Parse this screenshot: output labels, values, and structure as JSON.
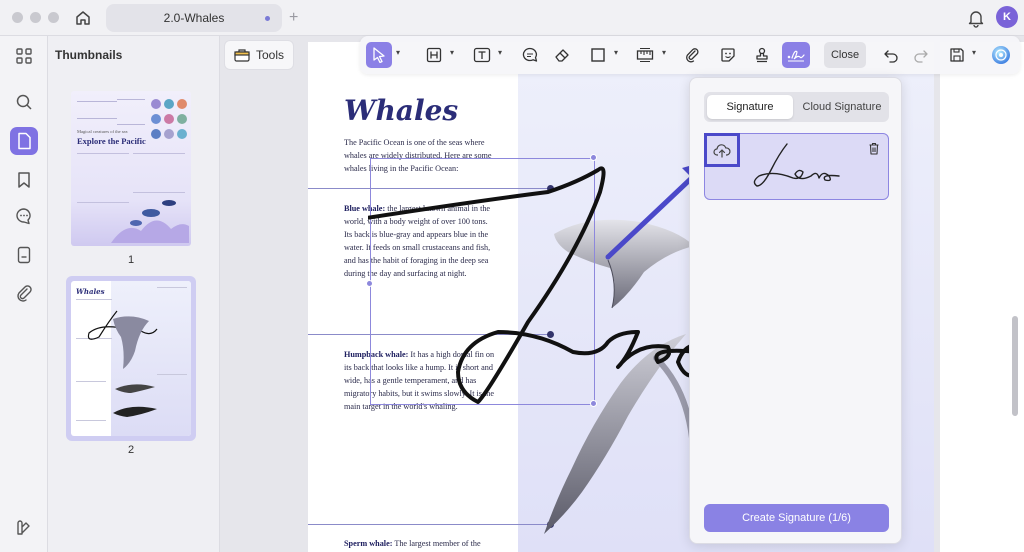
{
  "titlebar": {
    "tab_title": "2.0-Whales",
    "avatar_initial": "K"
  },
  "thumbnails": {
    "title": "Thumbnails",
    "pages": [
      {
        "number": "1"
      },
      {
        "number": "2"
      }
    ]
  },
  "thumb1": {
    "subtitle": "Magical creatures of the sea",
    "title": "Explore the Pacific"
  },
  "thumb2": {
    "title": "Whales"
  },
  "tools": {
    "label": "Tools"
  },
  "toolbar": {
    "close_label": "Close"
  },
  "document": {
    "title": "Whales",
    "intro": "The Pacific Ocean is one of the seas where whales are widely distributed. Here are some whales living in the Pacific Ocean:",
    "blue_whale": {
      "name": "Blue whale:",
      "text": " the largest known animal in the world, with a body weight of over 100 tons. Its back is blue-gray and appears blue in the water. It feeds on small crustaceans and fish, and has the habit of foraging in the deep sea during the day and surfacing at night."
    },
    "humpback_whale": {
      "name": "Humpback whale:",
      "text": " It has a high dorsal fin on its back that looks like a hump. It is short and wide, has a gentle temperament, and has migratory habits, but it swims slowly. It is the main target in the world's whaling."
    },
    "sperm_whale": {
      "name": "Sperm whale:",
      "text": " The largest member of the"
    }
  },
  "signature_panel": {
    "tab_signature": "Signature",
    "tab_cloud": "Cloud Signature",
    "create_button": "Create Signature (1/6)"
  },
  "colors": {
    "accent": "#8b80e6",
    "title_navy": "#2b2d78",
    "highlight_blue": "#4b49c9"
  }
}
